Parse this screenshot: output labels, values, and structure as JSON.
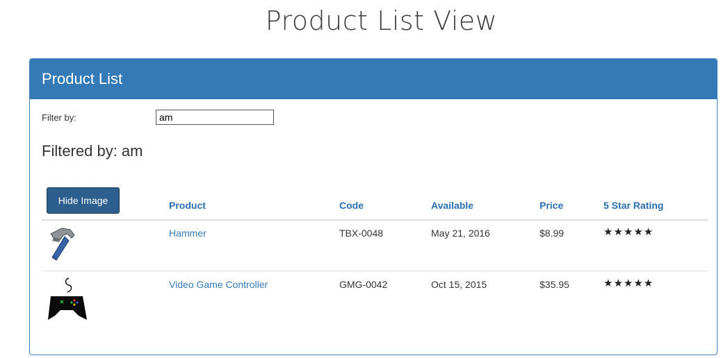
{
  "page": {
    "title": "Product List View"
  },
  "panel": {
    "heading": "Product List"
  },
  "filter": {
    "label": "Filter by:",
    "value": "am",
    "filtered_by_text": "Filtered by: am"
  },
  "table": {
    "hide_image_label": "Hide Image",
    "columns": [
      "Product",
      "Code",
      "Available",
      "Price",
      "5 Star Rating"
    ],
    "rows": [
      {
        "image": "hammer-image",
        "name": "Hammer",
        "code": "TBX-0048",
        "available": "May 21, 2016",
        "price": "$8.99",
        "rating": 5,
        "rating_stars": "★★★★★"
      },
      {
        "image": "game-controller-image",
        "name": "Video Game Controller",
        "code": "GMG-0042",
        "available": "Oct 15, 2015",
        "price": "$35.95",
        "rating": 4.5,
        "rating_stars": "★★★★★"
      }
    ]
  },
  "colors": {
    "panel_heading": "#337ab7",
    "link": "#337ab7",
    "button": "#2c5f8d"
  }
}
